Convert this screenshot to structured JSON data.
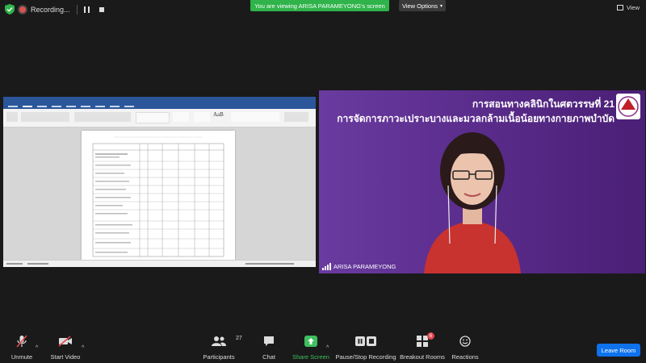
{
  "recording": {
    "label": "Recording..."
  },
  "banner": {
    "text": "You are viewing ARISA PARAMEYONG's screen"
  },
  "view_options": {
    "label": "View Options"
  },
  "view": {
    "label": "View"
  },
  "speaker": {
    "name": "ARISA PARAMEYONG",
    "slide_title_line1": "การสอนทางคลินิกในศตวรรษที่ 21",
    "slide_title_line2": "การจัดการภาวะเปราะบางและมวลกล้ามเนื้อน้อยทางกายภาพบำบัด"
  },
  "toolbar": {
    "unmute": "Unmute",
    "start_video": "Start Video",
    "participants": "Participants",
    "participants_count": "27",
    "chat": "Chat",
    "share_screen": "Share Screen",
    "pause_record": "Pause/Stop Recording",
    "breakout": "Breakout Rooms",
    "breakout_badge": "6",
    "reactions": "Reactions",
    "leave": "Leave Room"
  },
  "colors": {
    "share_green": "#2fb34a",
    "leave_blue": "#0e72ed",
    "slide_purple": "#5b2d8d",
    "word_blue": "#2b579a"
  }
}
